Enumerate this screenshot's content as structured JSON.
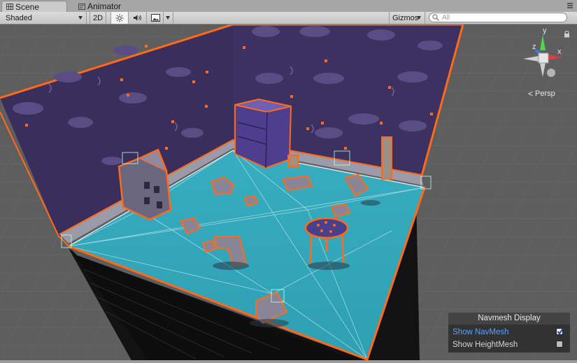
{
  "tabs": [
    {
      "label": "Scene",
      "active": true,
      "icon": "scene-grid-icon"
    },
    {
      "label": "Animator",
      "active": false,
      "icon": "animator-icon"
    }
  ],
  "toolbar": {
    "shading_mode": "Shaded",
    "mode_2d": "2D",
    "lighting_icon": "sun-icon",
    "audio_icon": "speaker-icon",
    "effects_icon": "image-icon",
    "gizmos_label": "Gizmos",
    "search_placeholder": "All",
    "search_value": ""
  },
  "scene": {
    "projection_label": "Persp",
    "axis_labels": {
      "x": "x",
      "y": "y",
      "z": "z"
    },
    "colors": {
      "navmesh": "#33a9bc",
      "wall": "#3a2f5c",
      "outline": "#ff6a1a",
      "background": "#5e5e5e"
    }
  },
  "navmesh_display": {
    "title": "Navmesh Display",
    "show_navmesh": {
      "label": "Show NavMesh",
      "checked": true
    },
    "show_heightmesh": {
      "label": "Show HeightMesh",
      "checked": false
    }
  }
}
